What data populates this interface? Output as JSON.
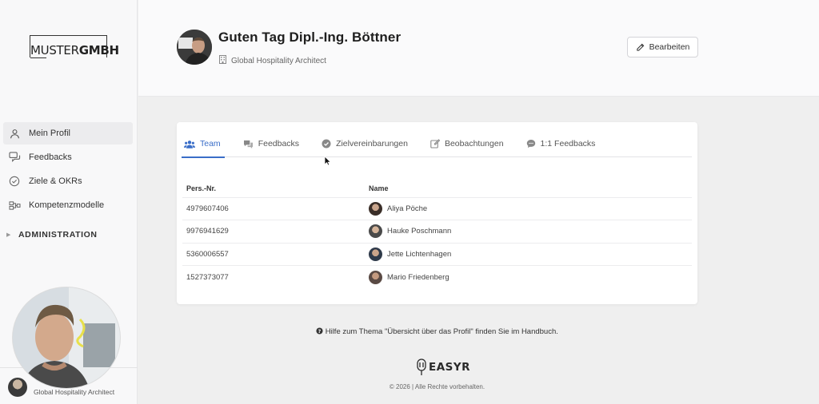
{
  "sidebar": {
    "logo_light": "MUSTER",
    "logo_bold": "GMBH",
    "items": [
      {
        "label": "Mein Profil",
        "icon": "user-icon",
        "active": true
      },
      {
        "label": "Feedbacks",
        "icon": "feedback-icon",
        "active": false
      },
      {
        "label": "Ziele & OKRs",
        "icon": "check-circle-icon",
        "active": false
      },
      {
        "label": "Kompetenzmodelle",
        "icon": "model-icon",
        "active": false
      }
    ],
    "admin_label": "ADMINISTRATION",
    "bottom_role": "Global Hospitality Architect"
  },
  "header": {
    "greeting": "Guten Tag Dipl.-Ing. Böttner",
    "job_title": "Global Hospitality Architect",
    "edit_label": "Bearbeiten"
  },
  "tabs": [
    {
      "label": "Team",
      "icon": "team-icon",
      "active": true
    },
    {
      "label": "Feedbacks",
      "icon": "feedback-icon",
      "active": false
    },
    {
      "label": "Zielvereinbarungen",
      "icon": "check-circle-icon",
      "active": false
    },
    {
      "label": "Beobachtungen",
      "icon": "edit-icon",
      "active": false
    },
    {
      "label": "1:1 Feedbacks",
      "icon": "chat-icon",
      "active": false
    }
  ],
  "table": {
    "columns": [
      "Pers.-Nr.",
      "Name"
    ],
    "rows": [
      {
        "pers_nr": "4979607406",
        "name": "Aliya Pöche"
      },
      {
        "pers_nr": "9976941629",
        "name": "Hauke Poschmann"
      },
      {
        "pers_nr": "5360006557",
        "name": "Jette Lichtenhagen"
      },
      {
        "pers_nr": "1527373077",
        "name": "Mario Friedenberg"
      }
    ]
  },
  "footer": {
    "help_text": "Hilfe zum Thema \"Übersicht über das Profil\" finden Sie im Handbuch.",
    "brand": "EASYR",
    "copyright": "© 2026 | Alle Rechte vorbehalten."
  },
  "colors": {
    "accent": "#3a6ec8",
    "background": "#efefef",
    "sidebar": "#f8f8f9"
  }
}
